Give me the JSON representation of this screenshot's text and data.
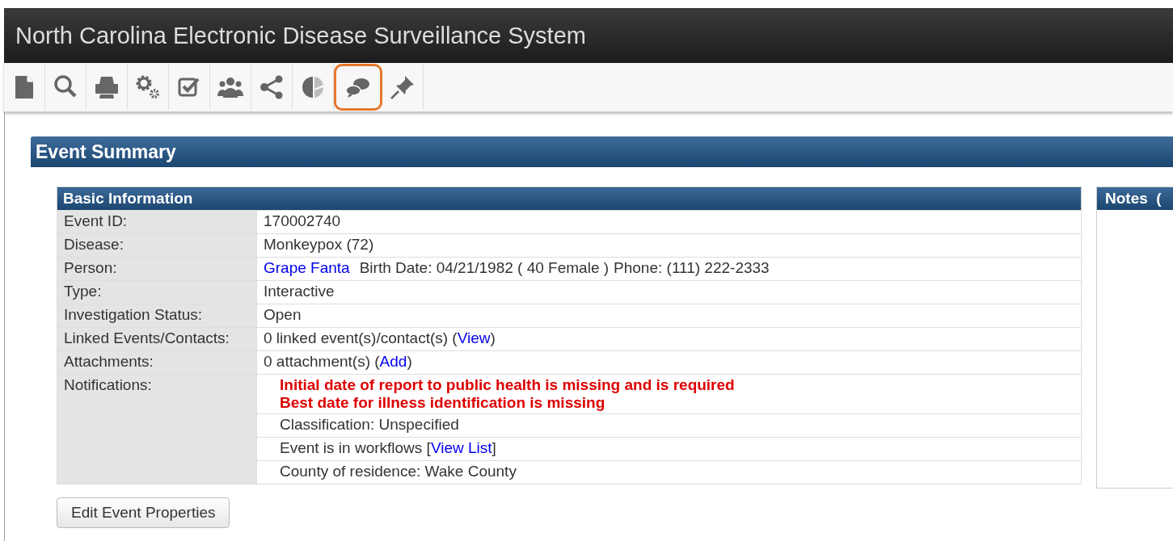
{
  "window": {
    "title": "North Carolina Electronic Disease Surveillance System"
  },
  "toolbar": [
    {
      "highlighted": false
    },
    {
      "highlighted": false
    },
    {
      "highlighted": false
    },
    {
      "highlighted": false
    },
    {
      "highlighted": false
    },
    {
      "highlighted": false
    },
    {
      "highlighted": false
    },
    {
      "highlighted": false
    },
    {
      "highlighted": true
    },
    {
      "highlighted": false
    }
  ],
  "event_summary": {
    "title": "Event Summary",
    "basic_information": {
      "title": "Basic Information",
      "rows": [
        {
          "label": "Event ID:",
          "lines": [
            [
              {
                "kind": "text",
                "text": "170002740"
              }
            ]
          ]
        },
        {
          "label": "Disease:",
          "lines": [
            [
              {
                "kind": "text",
                "text": "Monkeypox (72)"
              }
            ]
          ]
        },
        {
          "label": "Person:",
          "lines": [
            [
              {
                "kind": "link",
                "text": "Grape Fanta"
              },
              {
                "kind": "text",
                "text": "Birth Date: 04/21/1982 ( 40 Female )"
              },
              {
                "kind": "text",
                "text": "Phone: (111) 222-2333"
              }
            ]
          ]
        },
        {
          "label": "Type:",
          "lines": [
            [
              {
                "kind": "text",
                "text": "Interactive"
              }
            ]
          ]
        },
        {
          "label": "Investigation Status:",
          "lines": [
            [
              {
                "kind": "text",
                "text": "Open"
              }
            ]
          ]
        },
        {
          "label": "Linked Events/Contacts:",
          "lines": [
            [
              {
                "kind": "text",
                "text": "0 linked event(s)/contact(s) ("
              },
              {
                "kind": "link",
                "text": "View"
              },
              {
                "kind": "text",
                "text": ")"
              }
            ]
          ]
        },
        {
          "label": "Attachments:",
          "lines": [
            [
              {
                "kind": "text",
                "text": "0 attachment(s) ("
              },
              {
                "kind": "link",
                "text": "Add"
              },
              {
                "kind": "text",
                "text": ")"
              }
            ]
          ]
        },
        {
          "label": "Notifications:",
          "sublist": [
            {
              "lines": [
                [
                  {
                    "kind": "error",
                    "text": "Initial date of report to public health is missing and is required"
                  }
                ],
                [
                  {
                    "kind": "error",
                    "text": "Best date for illness identification is missing"
                  }
                ]
              ]
            },
            {
              "lines": [
                [
                  {
                    "kind": "text",
                    "text": "Classification: Unspecified"
                  }
                ]
              ]
            },
            {
              "lines": [
                [
                  {
                    "kind": "text",
                    "text": "Event is in workflows ["
                  },
                  {
                    "kind": "link",
                    "text": "View List"
                  },
                  {
                    "kind": "text",
                    "text": "]"
                  }
                ]
              ]
            },
            {
              "lines": [
                [
                  {
                    "kind": "text",
                    "text": "County of residence: Wake County"
                  }
                ]
              ]
            }
          ]
        }
      ]
    },
    "notes": {
      "title": "Notes  ("
    },
    "edit_button": "Edit Event Properties"
  }
}
